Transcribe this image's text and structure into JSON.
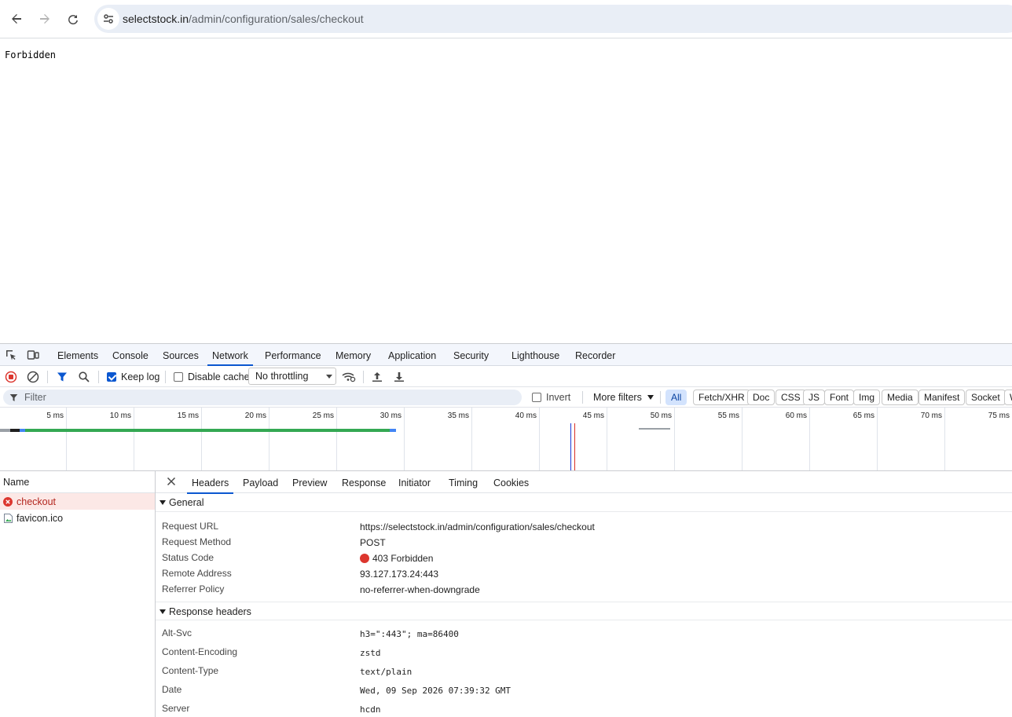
{
  "browser": {
    "url_host": "selectstock.in",
    "url_path": "/admin/configuration/sales/checkout"
  },
  "page": {
    "body_text": "Forbidden"
  },
  "devtools": {
    "tabs": [
      "Elements",
      "Console",
      "Sources",
      "Network",
      "Performance",
      "Memory",
      "Application",
      "Security",
      "Lighthouse",
      "Recorder"
    ],
    "active_tab": "Network",
    "toolbar": {
      "keep_log_label": "Keep log",
      "keep_log_checked": true,
      "disable_cache_label": "Disable cache",
      "disable_cache_checked": false,
      "throttling": "No throttling"
    },
    "filter": {
      "placeholder": "Filter",
      "invert_label": "Invert",
      "more_filters_label": "More filters",
      "chips": [
        "All",
        "Fetch/XHR",
        "Doc",
        "CSS",
        "JS",
        "Font",
        "Img",
        "Media",
        "Manifest",
        "Socket",
        "W"
      ],
      "active_chip": "All"
    },
    "timeline": {
      "ticks": [
        "5 ms",
        "10 ms",
        "15 ms",
        "20 ms",
        "25 ms",
        "30 ms",
        "35 ms",
        "40 ms",
        "45 ms",
        "50 ms",
        "55 ms",
        "60 ms",
        "65 ms",
        "70 ms",
        "75 ms"
      ]
    },
    "requests_header": "Name",
    "requests": [
      {
        "name": "checkout",
        "status": "error"
      },
      {
        "name": "favicon.ico",
        "status": "ok"
      }
    ],
    "detail_tabs": [
      "Headers",
      "Payload",
      "Preview",
      "Response",
      "Initiator",
      "Timing",
      "Cookies"
    ],
    "active_detail_tab": "Headers",
    "general": {
      "title": "General",
      "rows": [
        {
          "key": "Request URL",
          "value": "https://selectstock.in/admin/configuration/sales/checkout"
        },
        {
          "key": "Request Method",
          "value": "POST"
        },
        {
          "key": "Status Code",
          "value": "403 Forbidden"
        },
        {
          "key": "Remote Address",
          "value": "93.127.173.24:443"
        },
        {
          "key": "Referrer Policy",
          "value": "no-referrer-when-downgrade"
        }
      ]
    },
    "response_headers": {
      "title": "Response headers",
      "rows": [
        {
          "key": "Alt-Svc",
          "value": "h3=\":443\"; ma=86400"
        },
        {
          "key": "Content-Encoding",
          "value": "zstd"
        },
        {
          "key": "Content-Type",
          "value": "text/plain"
        },
        {
          "key": "Date",
          "value": "Wed, 09 Sep 2026 07:39:32 GMT"
        },
        {
          "key": "Server",
          "value": "hcdn"
        }
      ]
    },
    "colors": {
      "accent": "#0b57d0",
      "error": "#dc362e",
      "waterfall_green": "#34a853",
      "waterfall_blue": "#4285f4"
    }
  }
}
